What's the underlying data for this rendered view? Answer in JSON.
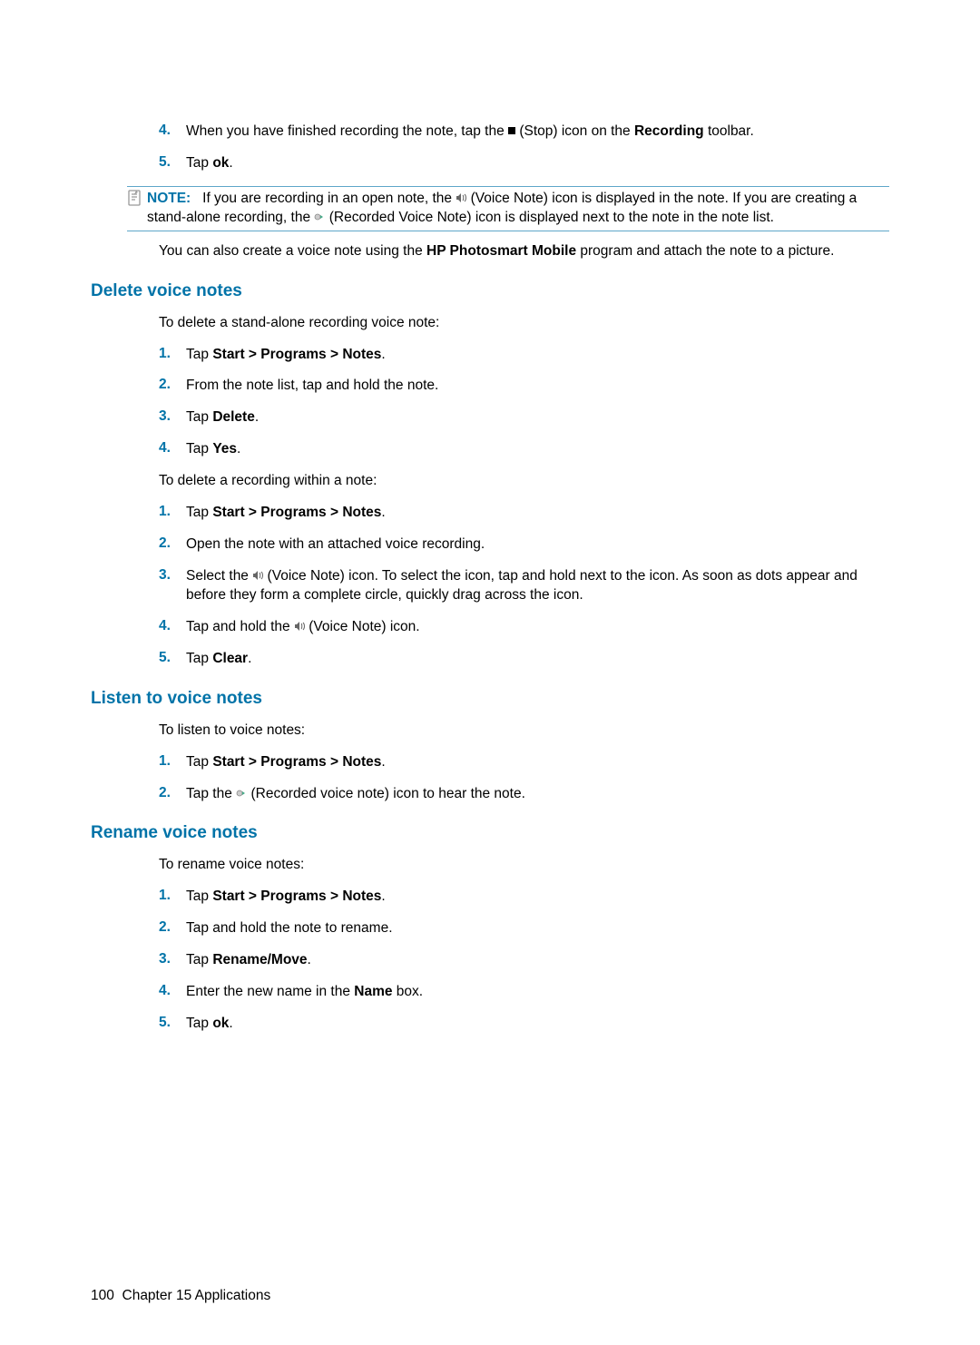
{
  "steps_top": [
    {
      "num": "4.",
      "pre": "When you have finished recording the note, tap the ",
      "icon": "stop",
      "mid": " (Stop) icon on the ",
      "bold": "Recording",
      "post": " toolbar."
    },
    {
      "num": "5.",
      "pre": "Tap ",
      "bold": "ok",
      "post": "."
    }
  ],
  "note": {
    "label": "NOTE:",
    "part1": "If you are recording in an open note, the ",
    "icon1": "voice",
    "part2": " (Voice Note) icon is displayed in the note. If you are creating a stand-alone recording, the ",
    "icon2": "recorded",
    "part3": " (Recorded Voice Note) icon is displayed next to the note in the note list."
  },
  "after_note": {
    "pre": "You can also create a voice note using the ",
    "bold": "HP Photosmart Mobile",
    "post": " program and attach the note to a picture."
  },
  "sections": {
    "delete": {
      "heading": "Delete voice notes",
      "intro1": "To delete a stand-alone recording voice note:",
      "list1": [
        {
          "num": "1.",
          "pre": "Tap ",
          "bold": "Start > Programs > Notes",
          "post": "."
        },
        {
          "num": "2.",
          "text": "From the note list, tap and hold the note."
        },
        {
          "num": "3.",
          "pre": "Tap ",
          "bold": "Delete",
          "post": "."
        },
        {
          "num": "4.",
          "pre": "Tap ",
          "bold": "Yes",
          "post": "."
        }
      ],
      "intro2": "To delete a recording within a note:",
      "list2": [
        {
          "num": "1.",
          "pre": "Tap ",
          "bold": "Start > Programs > Notes",
          "post": "."
        },
        {
          "num": "2.",
          "text": "Open the note with an attached voice recording."
        },
        {
          "num": "3.",
          "pre": "Select the ",
          "icon": "voice",
          "mid": " (Voice Note) icon. To select the icon, tap and hold next to the icon. As soon as dots appear and before they form a complete circle, quickly drag across the icon."
        },
        {
          "num": "4.",
          "pre": "Tap and hold the ",
          "icon": "voice",
          "mid": " (Voice Note) icon."
        },
        {
          "num": "5.",
          "pre": "Tap ",
          "bold": "Clear",
          "post": "."
        }
      ]
    },
    "listen": {
      "heading": "Listen to voice notes",
      "intro": "To listen to voice notes:",
      "list": [
        {
          "num": "1.",
          "pre": "Tap ",
          "bold": "Start > Programs > Notes",
          "post": "."
        },
        {
          "num": "2.",
          "pre": "Tap the ",
          "icon": "recorded",
          "mid": " (Recorded voice note) icon to hear the note."
        }
      ]
    },
    "rename": {
      "heading": "Rename voice notes",
      "intro": "To rename voice notes:",
      "list": [
        {
          "num": "1.",
          "pre": "Tap ",
          "bold": "Start > Programs > Notes",
          "post": "."
        },
        {
          "num": "2.",
          "text": "Tap and hold the note to rename."
        },
        {
          "num": "3.",
          "pre": "Tap ",
          "bold": "Rename/Move",
          "post": "."
        },
        {
          "num": "4.",
          "pre": "Enter the new name in the ",
          "bold": "Name",
          "post": " box."
        },
        {
          "num": "5.",
          "pre": "Tap ",
          "bold": "ok",
          "post": "."
        }
      ]
    }
  },
  "footer": {
    "page": "100",
    "chapter": "Chapter 15   Applications"
  }
}
